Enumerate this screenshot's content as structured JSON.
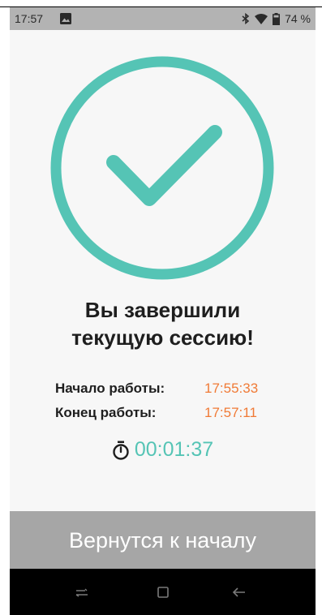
{
  "status_bar": {
    "time": "17:57",
    "battery": "74 %",
    "icons": [
      "image-icon",
      "bluetooth-icon",
      "wifi-icon",
      "battery-icon"
    ]
  },
  "main": {
    "title_line1": "Вы завершили",
    "title_line2": "текущую сессию!",
    "start_label": "Начало работы:",
    "start_value": "17:55:33",
    "end_label": "Конец работы:",
    "end_value": "17:57:11",
    "duration": "00:01:37",
    "back_button_label": "Вернутся к началу"
  },
  "colors": {
    "accent_teal": "#55c4b5",
    "time_orange": "#f07a36",
    "button_gray": "#a6a6a6"
  },
  "nav_bar": {
    "icons": [
      "recents-icon",
      "home-icon",
      "back-icon"
    ]
  }
}
